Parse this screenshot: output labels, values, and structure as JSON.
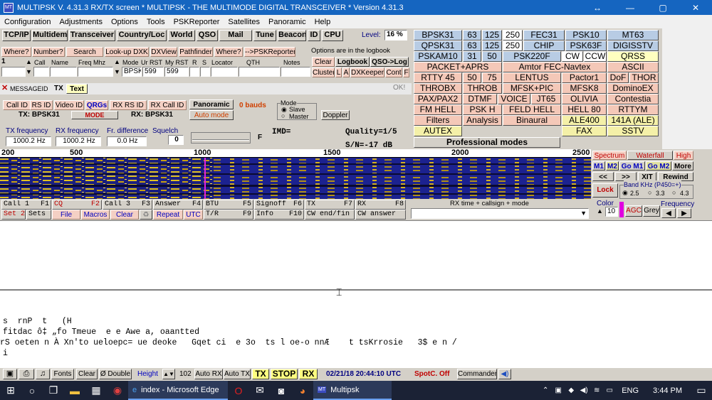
{
  "window": {
    "title": "MULTIPSK V. 4.31.3        RX/TX screen  * MULTIPSK - THE MULTIMODE DIGITAL TRANSCEIVER *  Version 4.31.3",
    "app_icon": "MT",
    "controls": [
      "↔",
      "—",
      "▢",
      "✕"
    ]
  },
  "menu": [
    "Configuration",
    "Adjustments",
    "Options",
    "Tools",
    "PSKReporter",
    "Satellites",
    "Panoramic",
    "Help"
  ],
  "toolbar": [
    "TCP/IP",
    "Multidem",
    "Transceiver",
    "Country/Loc",
    "World",
    "QSO",
    "Mail",
    "Tune",
    "Beacon",
    "ID",
    "CPU"
  ],
  "level": {
    "label": "Level:",
    "value": "16 %"
  },
  "log_buttons": [
    "Where?",
    "Number?",
    "Search",
    "Look-up DXK",
    "DXView",
    "Pathfinder",
    "Where?",
    "-->PSKReporter"
  ],
  "logbook_note": "Options are in the logbook",
  "log_headers": [
    "Call",
    "Name",
    "Freq Mhz",
    "Mode",
    "Ur RST",
    "My RST",
    "R",
    "S",
    "Locator",
    "QTH",
    "Notes"
  ],
  "log_values": {
    "index": "1",
    "mode": "BPSK",
    "ur_rst": "599",
    "my_rst": "599"
  },
  "log_side": [
    "Clear",
    "Logbook",
    "QSO->Log",
    "Cluster",
    "L",
    "A",
    "DXKeeper",
    "Cont",
    "F"
  ],
  "message": {
    "id": "MESSAGEID",
    "tx": "TX",
    "text": "Text",
    "ok": "OK!"
  },
  "id_buttons": [
    "Call ID",
    "RS ID",
    "Video ID",
    "QRGs",
    "RX RS ID",
    "RX Call ID",
    "Panoramic"
  ],
  "bauds": "0 bauds",
  "tx_mode": "TX: BPSK31",
  "mode_label": "MODE",
  "rx_mode": "RX: BPSK31",
  "auto_mode": "Auto mode",
  "mode_group": {
    "title": "Mode",
    "slave": "Slave",
    "master": "Master",
    "doppler": "Doppler"
  },
  "freq": {
    "tx_label": "TX frequency",
    "tx": "1000.2 Hz",
    "rx_label": "RX frequency",
    "rx": "1000.2 Hz",
    "diff_label": "Fr. difference",
    "diff": "0.0 Hz",
    "squelch_label": "Squelch",
    "squelch": "0",
    "f": "F"
  },
  "imd": "IMD=",
  "quality": "Quality=1/5",
  "sn": "S/N=-17 dB",
  "modes": [
    [
      "BPSK31",
      "63",
      "125",
      "250",
      "FEC31",
      "PSK10",
      "MT63"
    ],
    [
      "QPSK31",
      "63",
      "125",
      "250",
      "CHIP",
      "PSK63F",
      "DIGISSTV"
    ],
    [
      "PSKAM10",
      "31",
      "50",
      "PSK220F",
      "CW",
      "CCW",
      "QRSS"
    ],
    [
      "PACKET+APRS",
      "Amtor FEC-Navtex",
      "ASCII"
    ],
    [
      "RTTY 45",
      "50",
      "75",
      "LENTUS",
      "Pactor1",
      "DoF",
      "THOR"
    ],
    [
      "THROBX",
      "THROB",
      "MFSK+PIC",
      "MFSK8",
      "DominoEX"
    ],
    [
      "PAX/PAX2",
      "DTMF",
      "VOICE",
      "JT65",
      "OLIVIA",
      "Contestia"
    ],
    [
      "FM HELL",
      "PSK H",
      "FELD HELL",
      "HELL 80",
      "RTTYM"
    ],
    [
      "Filters",
      "Analysis",
      "Binaural",
      "ALE400",
      "141A (ALE)"
    ],
    [
      "AUTEX",
      "FAX",
      "SSTV"
    ]
  ],
  "professional": "Professional modes",
  "scale": [
    "200",
    "500",
    "1000",
    "1500",
    "2000",
    "2500"
  ],
  "wf_controls": {
    "spectrum": "Spectrum",
    "waterfall": "Waterfall",
    "high": "High",
    "m1": "M1",
    "m2": "M2",
    "gom1": "Go M1",
    "gom2": "Go M2",
    "more": "More",
    "prev": "<<",
    "next": ">>",
    "xit": "XIT",
    "rewind": "Rewind",
    "lock": "Lock",
    "band": "Band KHz (P450=+)",
    "b1": "2.5",
    "b2": "3.3",
    "b3": "4.3",
    "color": "Color",
    "color_val": "10",
    "agc": "AGC",
    "grey": "Grey",
    "frequency": "Frequency"
  },
  "fkeys": [
    {
      "l": "Call 1",
      "k": "F1"
    },
    {
      "l": "CQ",
      "k": "F2"
    },
    {
      "l": "Call 3",
      "k": "F3"
    },
    {
      "l": "Answer",
      "k": "F4"
    },
    {
      "l": "BTU",
      "k": "F5"
    },
    {
      "l": "Signoff",
      "k": "F6"
    },
    {
      "l": "TX",
      "k": "F7"
    },
    {
      "l": "RX",
      "k": "F8"
    },
    {
      "l": "Set 2",
      "k": ""
    },
    {
      "l": "Sets",
      "k": ""
    },
    {
      "l": "File",
      "k": ""
    },
    {
      "l": "Macros",
      "k": ""
    },
    {
      "l": "Clear",
      "k": ""
    },
    {
      "l": "Repeat",
      "k": ""
    },
    {
      "l": "UTC",
      "k": ""
    },
    {
      "l": "T/R",
      "k": "F9"
    },
    {
      "l": "Info",
      "k": "F10"
    },
    {
      "l": "CW end/fin",
      "k": ""
    },
    {
      "l": "CW answer",
      "k": ""
    }
  ],
  "rx_callsign": "RX time + callsign + mode",
  "rx_lines": [
    "s  rnP  t   (H",
    "fitdac ô‡ „fo Tmeue  e e Awe a, oaantted",
    "rS oeten n À Xn'to ueloepc= ue deoke   Gqet ci  e 3o  ts l oe-o nnÆ    t tsKrrosie   3$ e n /",
    "i"
  ],
  "bottom": {
    "fonts": "Fonts",
    "clear": "Clear",
    "double": "Double",
    "height": "Height",
    "num": "102",
    "autorx": "Auto RX",
    "autotx": "Auto TX",
    "tx": "TX",
    "stop": "STOP",
    "rx": "RX",
    "time": "02/21/18 20:44:10 UTC",
    "spotc": "SpotC. Off",
    "commander": "Commander"
  },
  "taskbar": {
    "edge_label": "index - Microsoft Edge",
    "multipsk": "Multipsk",
    "lang": "ENG",
    "time": "3:44 PM"
  }
}
